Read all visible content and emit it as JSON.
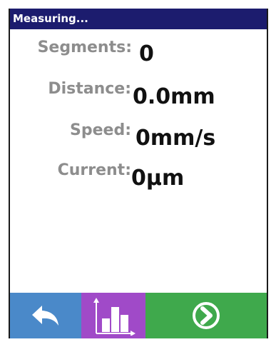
{
  "title_bar": {
    "title": "Measuring..."
  },
  "readings": [
    {
      "label": "Segments:",
      "value": "0"
    },
    {
      "label": "Distance:",
      "value": "0.0mm"
    },
    {
      "label": "Speed:",
      "value": "0mm/s"
    },
    {
      "label": "Current:",
      "value": "0µm"
    }
  ],
  "toolbar": {
    "back": {
      "icon": "back-arrow-icon",
      "color": "#4a89c9"
    },
    "chart": {
      "icon": "bar-chart-icon",
      "color": "#a04ac8"
    },
    "next": {
      "icon": "circle-chevron-right-icon",
      "color": "#3fa94c"
    }
  },
  "colors": {
    "title_bar": "#1c1c6e",
    "label_text": "#8d8d8d",
    "value_text": "#111111"
  }
}
